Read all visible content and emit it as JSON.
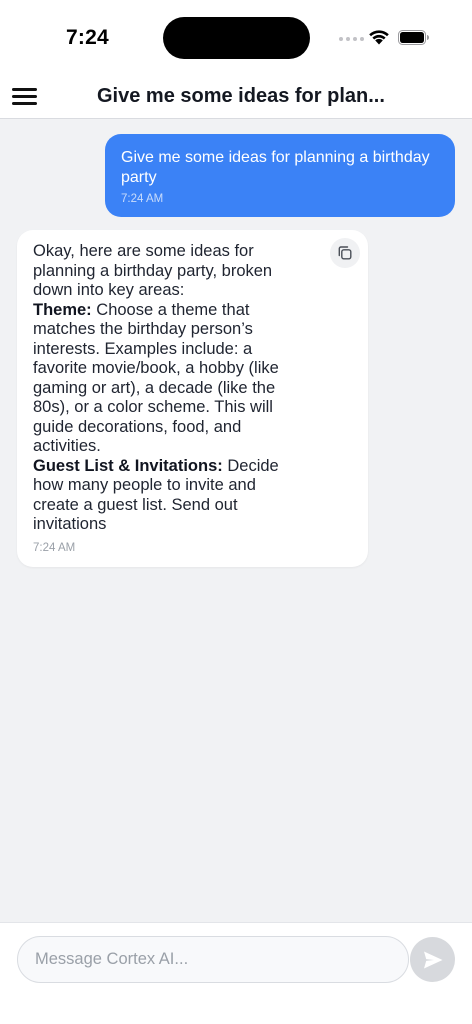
{
  "status_bar": {
    "time": "7:24"
  },
  "header": {
    "title": "Give me some ideas for plan..."
  },
  "messages": {
    "user": {
      "text": "Give me some ideas for planning a birthday party",
      "time": "7:24 AM"
    },
    "assistant": {
      "intro": "Okay, here are some ideas for planning a birthday party, broken down into key areas:",
      "theme_label": "Theme:",
      "theme_text": " Choose a theme that matches the birthday person’s interests. Examples include: a favorite movie/book, a hobby (like gaming or art), a decade (like the 80s), or a color scheme.  This will guide decorations, food, and activities.",
      "guest_label": "Guest List & Invitations:",
      "guest_text": " Decide how many people to invite and create a guest list. Send out invitations",
      "time": "7:24 AM"
    }
  },
  "composer": {
    "placeholder": "Message Cortex AI..."
  },
  "colors": {
    "accent": "#3b82f6",
    "background": "#f1f2f4",
    "send_disabled": "#d7d9dd"
  },
  "icons": [
    "menu-icon",
    "copy-icon",
    "send-icon",
    "wifi-icon",
    "battery-icon"
  ]
}
